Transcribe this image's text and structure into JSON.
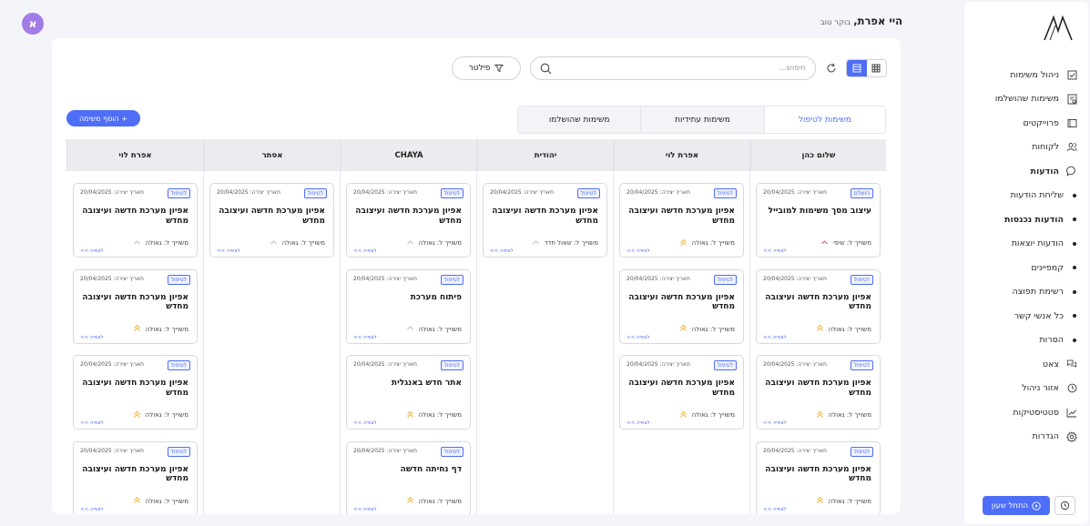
{
  "sidebar": {
    "items": [
      {
        "label": "ניהול משימות",
        "icon": "checkbox-icon",
        "bold": false,
        "sub": false
      },
      {
        "label": "משימות שהושלמו",
        "icon": "document-check-icon",
        "bold": false,
        "sub": false
      },
      {
        "label": "פרוייקטים",
        "icon": "folder-icon",
        "bold": false,
        "sub": false
      },
      {
        "label": "לקוחות",
        "icon": "users-icon",
        "bold": false,
        "sub": false
      },
      {
        "label": "הודעות",
        "icon": "chat-icon",
        "bold": true,
        "sub": false
      },
      {
        "label": "שליחת הודעות",
        "icon": "bullet-icon",
        "bold": false,
        "sub": true
      },
      {
        "label": "הודעות נכנסות",
        "icon": "bullet-icon",
        "bold": true,
        "sub": true
      },
      {
        "label": "הודעות יוצאות",
        "icon": "bullet-icon",
        "bold": false,
        "sub": true
      },
      {
        "label": "קמפיינים",
        "icon": "bullet-icon",
        "bold": false,
        "sub": true
      },
      {
        "label": "רשימת תפוצה",
        "icon": "bullet-icon",
        "bold": false,
        "sub": true
      },
      {
        "label": "כל אנשי קשר",
        "icon": "bullet-icon",
        "bold": false,
        "sub": true
      },
      {
        "label": "הסרות",
        "icon": "bullet-icon",
        "bold": false,
        "sub": true
      },
      {
        "label": "צאט",
        "icon": "chat-bubbles-icon",
        "bold": false,
        "sub": false
      },
      {
        "label": "אזור ניהול",
        "icon": "clock-icon",
        "bold": false,
        "sub": false
      },
      {
        "label": "סטטיסטיקות",
        "icon": "chart-icon",
        "bold": false,
        "sub": false
      },
      {
        "label": "הגדרות",
        "icon": "gear-icon",
        "bold": false,
        "sub": false
      }
    ],
    "start_shift": "התחל שעון"
  },
  "header": {
    "greeting": "היי אפרת,",
    "sub_greeting": "בוקר טוב",
    "avatar_letter": "א"
  },
  "toolbar": {
    "search_placeholder": "חיפוש...",
    "filter_label": "פילטר",
    "add_task": "+ הוסף משימה"
  },
  "tabs": [
    "משימות לטיפול",
    "משימות עתידיות",
    "משימות שהושלמו"
  ],
  "colors": {
    "accent": "#4f6ef7",
    "prio_high": "#f2b23a",
    "prio_low": "#b9bcc6",
    "prio_urgent": "#e85a5a"
  },
  "columns": [
    {
      "name": "שלום כהן",
      "cards": [
        {
          "badge": "הושלם",
          "date": "תאריך יצירה: 20/04/2025",
          "title": "עיצוב מסך משימות למובייל",
          "assignee": "משוייך ל: שיפי",
          "prio": "urgent",
          "link": "לצפיה >>"
        },
        {
          "badge": "לטיפול",
          "date": "תאריך יצירה: 20/04/2025",
          "title": "אפיון מערכת חדשה ועיצובה מחדש",
          "assignee": "משוייך ל: גאולה",
          "prio": "high",
          "link": "לצפיה >>"
        },
        {
          "badge": "לטיפול",
          "date": "תאריך יצירה: 20/04/2025",
          "title": "אפיון מערכת חדשה ועיצובה מחדש",
          "assignee": "משוייך ל: גאולה",
          "prio": "high",
          "link": "לצפיה >>"
        },
        {
          "badge": "לטיפול",
          "date": "תאריך יצירה: 20/04/2025",
          "title": "אפיון מערכת חדשה ועיצובה מחדש",
          "assignee": "משוייך ל: גאולה",
          "prio": "high",
          "link": "לצפיה >>"
        }
      ]
    },
    {
      "name": "אפרת לוי",
      "cards": [
        {
          "badge": "לטיפול",
          "date": "תאריך יצירה: 20/04/2025",
          "title": "אפיון מערכת חדשה ועיצובה מחדש",
          "assignee": "משוייך ל: גאולה",
          "prio": "high",
          "link": "לצפיה >>"
        },
        {
          "badge": "לטיפול",
          "date": "תאריך יצירה: 20/04/2025",
          "title": "אפיון מערכת חדשה ועיצובה מחדש",
          "assignee": "משוייך ל: גאולה",
          "prio": "high",
          "link": "לצפיה >>"
        },
        {
          "badge": "לטיפול",
          "date": "תאריך יצירה: 20/04/2025",
          "title": "אפיון מערכת חדשה ועיצובה מחדש",
          "assignee": "משוייך ל: גאולה",
          "prio": "high",
          "link": "לצפיה >>"
        }
      ]
    },
    {
      "name": "יהודית",
      "cards": [
        {
          "badge": "לטיפול",
          "date": "תאריך יצירה: 20/04/2025",
          "title": "אפיון מערכת חדשה ועיצובה מחדש",
          "assignee": "משוייך ל: שאול חדד",
          "prio": "low",
          "link": "לצפיה >>"
        }
      ]
    },
    {
      "name": "CHAYA",
      "cards": [
        {
          "badge": "לטיפול",
          "date": "תאריך יצירה: 20/04/2025",
          "title": "אפיון מערכת חדשה ועיצובה מחדש",
          "assignee": "משוייך ל: גאולה",
          "prio": "low",
          "link": "לצפיה >>"
        },
        {
          "badge": "לטיפול",
          "date": "תאריך יצירה: 20/04/2025",
          "title": "פיתוח מערכת",
          "assignee": "משוייך ל: גאולה",
          "prio": "low",
          "link": "לצפיה >>"
        },
        {
          "badge": "לטיפול",
          "date": "תאריך יצירה: 20/04/2025",
          "title": "אתר חדש באנגלית",
          "assignee": "משוייך ל: גאולה",
          "prio": "high",
          "link": "לצפיה >>"
        },
        {
          "badge": "לטיפול",
          "date": "תאריך יצירה: 20/04/2025",
          "title": "דף נחיתה חדשה",
          "assignee": "משוייך ל: גאולה",
          "prio": "high",
          "link": "לצפיה >>"
        }
      ]
    },
    {
      "name": "אסתר",
      "cards": [
        {
          "badge": "לטיפול",
          "date": "תאריך יצירה: 20/04/2025",
          "title": "אפיון מערכת חדשה ועיצובה מחדש",
          "assignee": "משוייך ל: גאולה",
          "prio": "low",
          "link": "לצפיה >>"
        }
      ]
    },
    {
      "name": "אפרת לוי",
      "cards": [
        {
          "badge": "לטיפול",
          "date": "תאריך יצירה: 20/04/2025",
          "title": "אפיון מערכת חדשה ועיצובה מחדש",
          "assignee": "משוייך ל: גאולה",
          "prio": "low",
          "link": "לצפיה >>"
        },
        {
          "badge": "לטיפול",
          "date": "תאריך יצירה: 20/04/2025",
          "title": "אפיון מערכת חדשה ועיצובה מחדש",
          "assignee": "משוייך ל: גאולה",
          "prio": "high",
          "link": "לצפיה >>"
        },
        {
          "badge": "לטיפול",
          "date": "תאריך יצירה: 20/04/2025",
          "title": "אפיון מערכת חדשה ועיצובה מחדש",
          "assignee": "משוייך ל: גאולה",
          "prio": "high",
          "link": "לצפיה >>"
        },
        {
          "badge": "לטיפול",
          "date": "תאריך יצירה: 20/04/2025",
          "title": "אפיון מערכת חדשה ועיצובה מחדש",
          "assignee": "משוייך ל: גאולה",
          "prio": "high",
          "link": "לצפיה >>"
        }
      ]
    }
  ]
}
